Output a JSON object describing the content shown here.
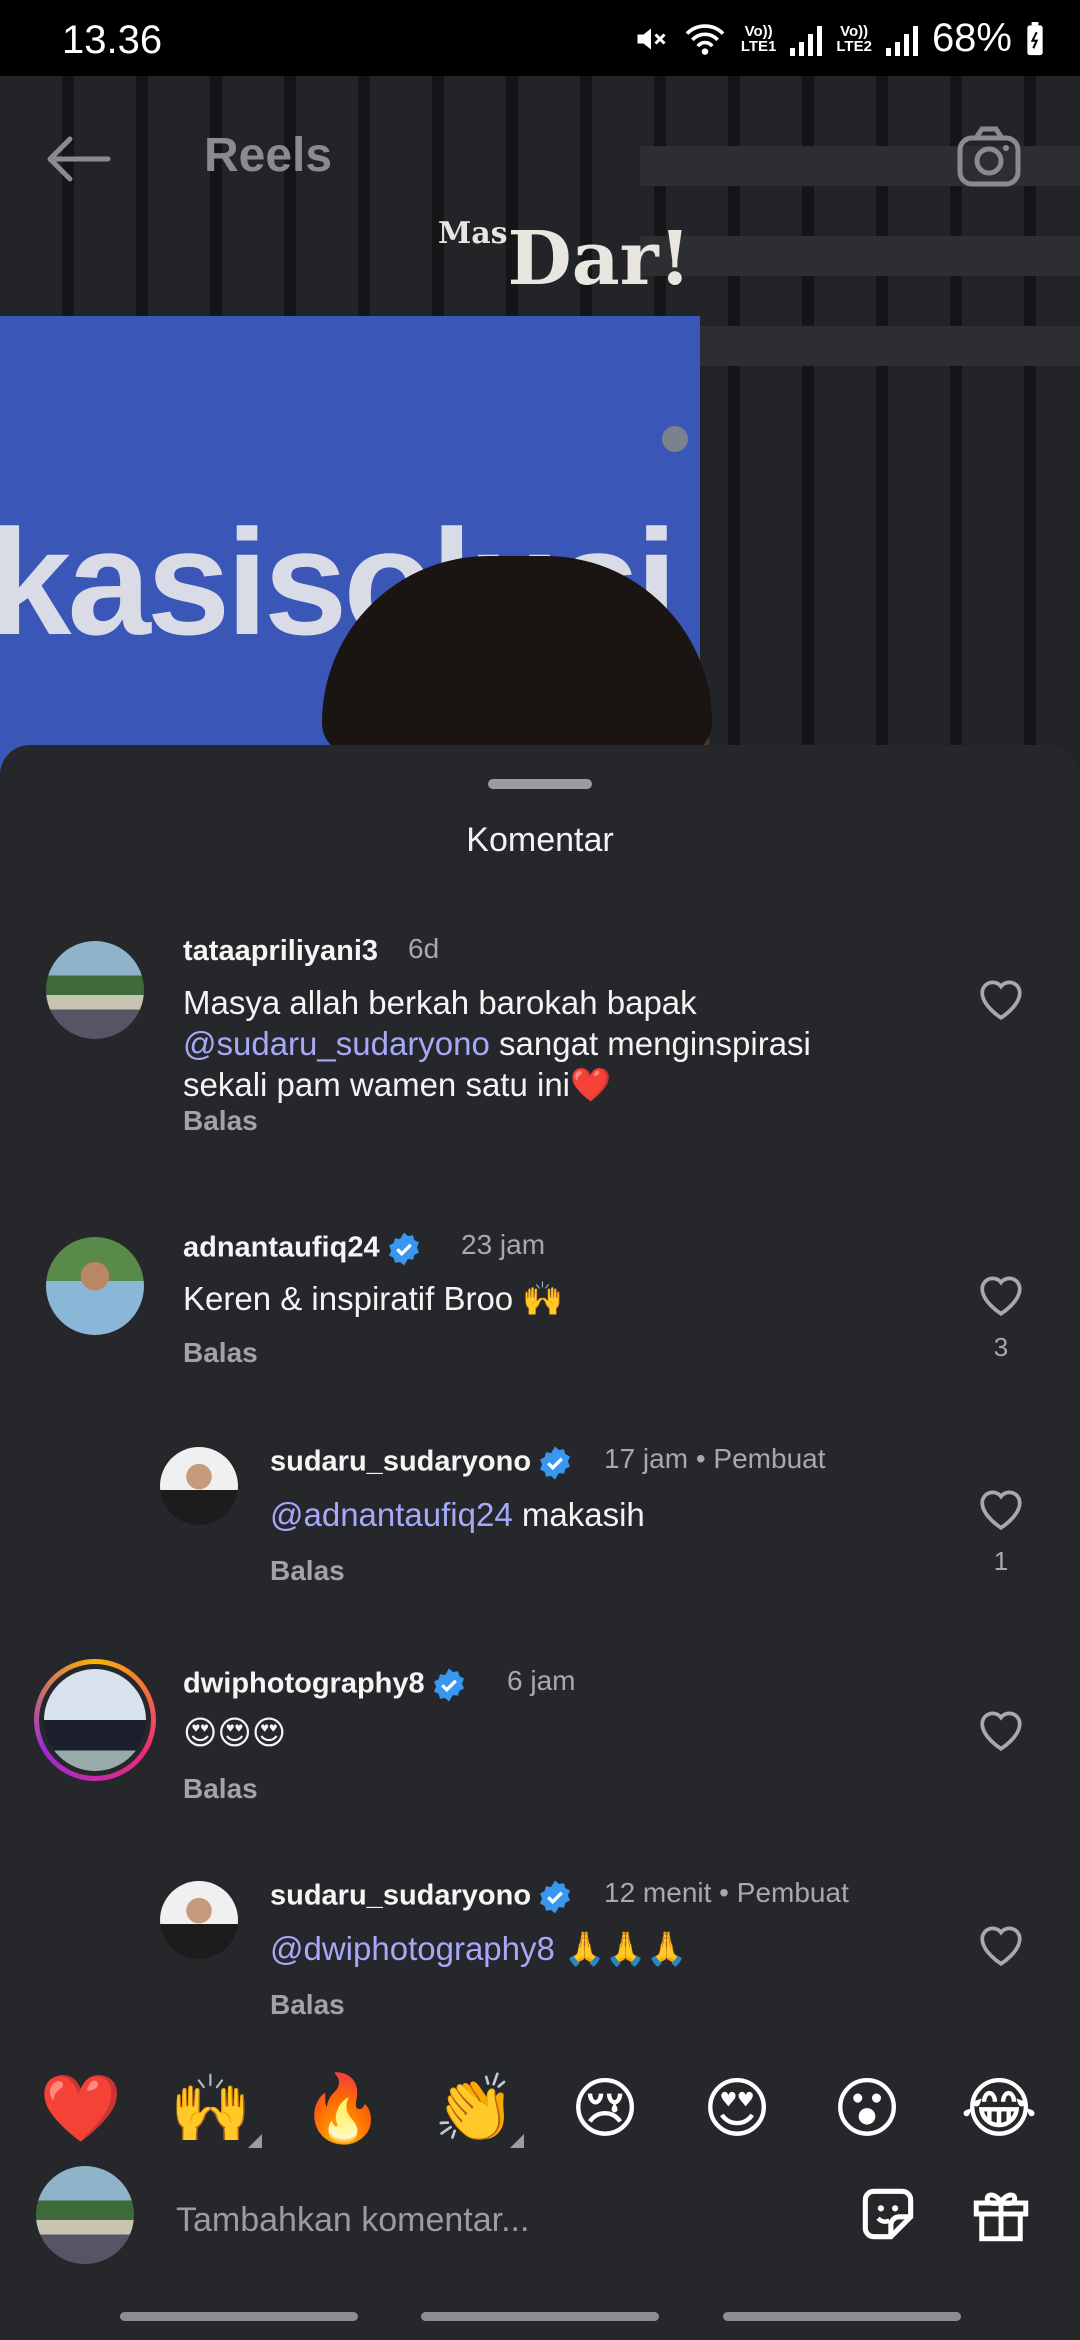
{
  "status": {
    "time": "13.36",
    "battery": "68%",
    "sim1": [
      "Vo))",
      "LTE1"
    ],
    "sim2": [
      "Vo))",
      "LTE2"
    ]
  },
  "header": {
    "title": "Reels",
    "watermark_small": "Mas",
    "watermark": "Dar!",
    "video_sign_text": "kasisolusi"
  },
  "sheet": {
    "title": "Komentar"
  },
  "comments": [
    {
      "username": "tataapriliyani3",
      "time": "6d",
      "text_line1": "Masya allah berkah barokah bapak",
      "mention": "@sudaru_sudaryono",
      "text_line2": " sangat menginspirasi",
      "text_line3": "sekali pam wamen satu ini❤️",
      "reply_label": "Balas",
      "likes": ""
    },
    {
      "username": "adnantaufiq24",
      "time": "23 jam",
      "text": "Keren & inspiratif Broo 🙌",
      "reply_label": "Balas",
      "likes": "3"
    },
    {
      "username": "sudaru_sudaryono",
      "time": "17 jam",
      "creator_label": "Pembuat",
      "mention": "@adnantaufiq24",
      "text": " makasih",
      "reply_label": "Balas",
      "likes": "1"
    },
    {
      "username": "dwiphotography8",
      "time": "6 jam",
      "text": "😍😍😍",
      "reply_label": "Balas",
      "likes": ""
    },
    {
      "username": "sudaru_sudaryono",
      "time": "12 menit",
      "creator_label": "Pembuat",
      "mention": "@dwiphotography8",
      "text": " 🙏🙏🙏",
      "reply_label": "Balas",
      "likes": ""
    }
  ],
  "quick_emojis": [
    "❤️",
    "🙌",
    "🔥",
    "👏",
    "😢",
    "😍",
    "😮",
    "😂"
  ],
  "input": {
    "placeholder": "Tambahkan komentar..."
  },
  "colors": {
    "sheet_bg": "#25272b",
    "mention": "#a5a9f8",
    "verified": "#3897f0",
    "heart_red": "#ff3b5c"
  }
}
